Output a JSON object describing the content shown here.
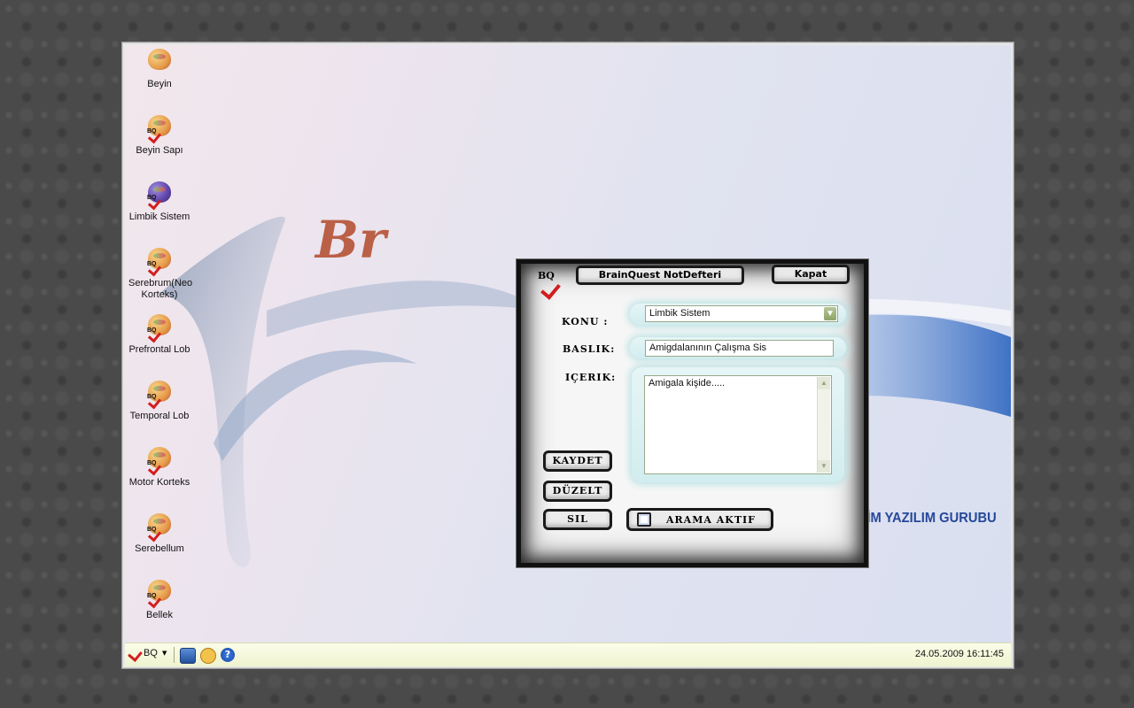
{
  "desktop": {
    "icons": [
      {
        "label": "Beyin",
        "icon": "brain-icon"
      },
      {
        "label": "Beyin Sapı",
        "icon": "brainstem-icon"
      },
      {
        "label": "Limbik Sistem",
        "icon": "limbic-system-icon"
      },
      {
        "label": "Serebrum(Neo Korteks)",
        "icon": "cerebrum-icon"
      },
      {
        "label": "Prefrontal Lob",
        "icon": "prefrontal-lobe-icon"
      },
      {
        "label": "Temporal Lob",
        "icon": "temporal-lobe-icon"
      },
      {
        "label": "Motor Korteks",
        "icon": "motor-cortex-icon"
      },
      {
        "label": "Serebellum",
        "icon": "cerebellum-icon"
      },
      {
        "label": "Bellek",
        "icon": "memory-icon"
      }
    ],
    "brand_text": "KSÜ BÖTE- EĞİTİM YAZILIM GURUBU",
    "watermark_logo": "Br"
  },
  "dialog": {
    "logo": "BQ",
    "title": "BrainQuest NotDefteri",
    "close_label": "Kapat",
    "konu_label": "KONU :",
    "konu_value": "Limbik Sistem",
    "baslik_label": "BASLIK:",
    "baslik_value": "Amigdalanının Çalışma Sis",
    "icerik_label": "IÇERIK:",
    "icerik_value": "Amigala kişide.....",
    "save_label": "KAYDET",
    "edit_label": "DÜZELT",
    "delete_label": "SIL",
    "search_label": "ARAMA AKTIF",
    "search_active": false
  },
  "taskbar": {
    "start_label": "BQ",
    "icons": [
      "book-icon",
      "search-icon",
      "help-icon"
    ],
    "clock": "24.05.2009 16:11:45"
  },
  "colors": {
    "brand": "#27489a",
    "check_red": "#d21e1e",
    "field_glow": "#bfe3e6"
  }
}
